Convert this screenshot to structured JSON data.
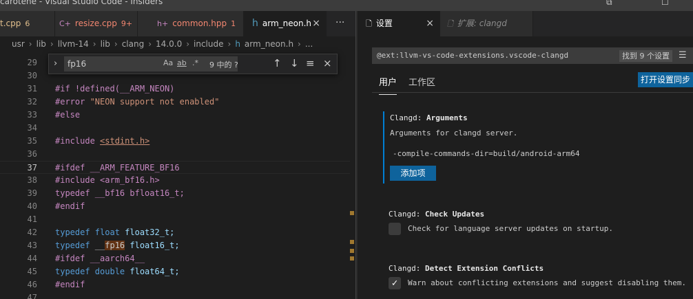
{
  "window": {
    "title": "carotene - Visual Studio Code - Insiders",
    "buttons": [
      "restore-icon",
      "maximize-icon"
    ]
  },
  "left_tabs": [
    {
      "icon": "",
      "name": "t.cpp",
      "badge": "6",
      "color": "#e2c08d"
    },
    {
      "icon": "C+",
      "name": "resize.cpp",
      "badge": "9+",
      "color": "#f48771"
    },
    {
      "icon": "h+",
      "name": "common.hpp",
      "badge": "1",
      "color": "#f48771"
    },
    {
      "icon": "h",
      "name": "arm_neon.h",
      "badge": "",
      "color": "#ffffff",
      "close": "×"
    }
  ],
  "more_actions": "···",
  "breadcrumb": [
    "usr",
    "lib",
    "llvm-14",
    "lib",
    "clang",
    "14.0.0",
    "include",
    "arm_neon.h",
    "..."
  ],
  "find": {
    "query": "fp16",
    "options": [
      "Aa",
      "ab",
      ".*"
    ],
    "count": "9 中的 ?",
    "buttons": [
      "↑",
      "↓",
      "≡",
      "×"
    ]
  },
  "code_lines": [
    {
      "n": "29",
      "tokens": []
    },
    {
      "n": "30",
      "tokens": []
    },
    {
      "n": "31",
      "tokens": [
        {
          "t": "#if !defined(__ARM_NEON)",
          "c": "kw-pre"
        }
      ]
    },
    {
      "n": "32",
      "tokens": [
        {
          "t": "#error ",
          "c": "kw-pre"
        },
        {
          "t": "\"NEON support not enabled\"",
          "c": "str"
        }
      ]
    },
    {
      "n": "33",
      "tokens": [
        {
          "t": "#else",
          "c": "kw-pre"
        }
      ]
    },
    {
      "n": "34",
      "tokens": []
    },
    {
      "n": "35",
      "tokens": [
        {
          "t": "#include ",
          "c": "kw-pre"
        },
        {
          "t": "<stdint.h>",
          "c": "inc"
        }
      ]
    },
    {
      "n": "36",
      "tokens": []
    },
    {
      "n": "37",
      "tokens": [
        {
          "t": "#ifdef __ARM_FEATURE_BF16",
          "c": "kw-pre"
        }
      ],
      "current": true
    },
    {
      "n": "38",
      "tokens": [
        {
          "t": "#include <arm_bf16.h>",
          "c": "kw-pre"
        }
      ]
    },
    {
      "n": "39",
      "tokens": [
        {
          "t": "typedef __bf16 bfloat16_t;",
          "c": "kw-pre"
        }
      ]
    },
    {
      "n": "40",
      "tokens": [
        {
          "t": "#endif",
          "c": "kw-pre"
        }
      ]
    },
    {
      "n": "41",
      "tokens": []
    },
    {
      "n": "42",
      "tokens": [
        {
          "t": "typedef ",
          "c": "kw-type"
        },
        {
          "t": "float ",
          "c": "kw-type"
        },
        {
          "t": "float32_t;",
          "c": "ident2"
        }
      ]
    },
    {
      "n": "43",
      "tokens": [
        {
          "t": "typedef ",
          "c": "kw-type"
        },
        {
          "t": "__",
          "c": "ident"
        },
        {
          "t": "fp16",
          "c": "ident match"
        },
        {
          "t": " float16_t;",
          "c": "ident2"
        }
      ]
    },
    {
      "n": "44",
      "tokens": [
        {
          "t": "#ifdef __aarch64__",
          "c": "kw-pre"
        }
      ]
    },
    {
      "n": "45",
      "tokens": [
        {
          "t": "typedef ",
          "c": "kw-type"
        },
        {
          "t": "double ",
          "c": "kw-type"
        },
        {
          "t": "float64_t;",
          "c": "ident2"
        }
      ]
    },
    {
      "n": "46",
      "tokens": [
        {
          "t": "#endif",
          "c": "kw-pre"
        }
      ]
    },
    {
      "n": "47",
      "tokens": []
    }
  ],
  "right_tabs": [
    {
      "icon": "file-icon",
      "name": "设置",
      "close": "×"
    },
    {
      "icon": "file-icon",
      "name": "扩展: clangd"
    }
  ],
  "settings": {
    "search_query": "@ext:llvm-vs-code-extensions.vscode-clangd",
    "found": "找到 9 个设置",
    "tabs": [
      "用户",
      "工作区"
    ],
    "sync_button": "打开设置同步",
    "items": [
      {
        "prefix": "Clangd: ",
        "name": "Arguments",
        "desc": "Arguments for clangd server.",
        "value": "-compile-commands-dir=build/android-arm64",
        "add_label": "添加项"
      },
      {
        "prefix": "Clangd: ",
        "name": "Check Updates",
        "desc": "Check for language server updates on startup.",
        "checked": false
      },
      {
        "prefix": "Clangd: ",
        "name": "Detect Extension Conflicts",
        "desc": "Warn about conflicting extensions and suggest disabling them.",
        "checked": true
      }
    ]
  },
  "colors": {
    "accent": "#0e639c",
    "focus": "#007fd4",
    "match": "#613214"
  }
}
